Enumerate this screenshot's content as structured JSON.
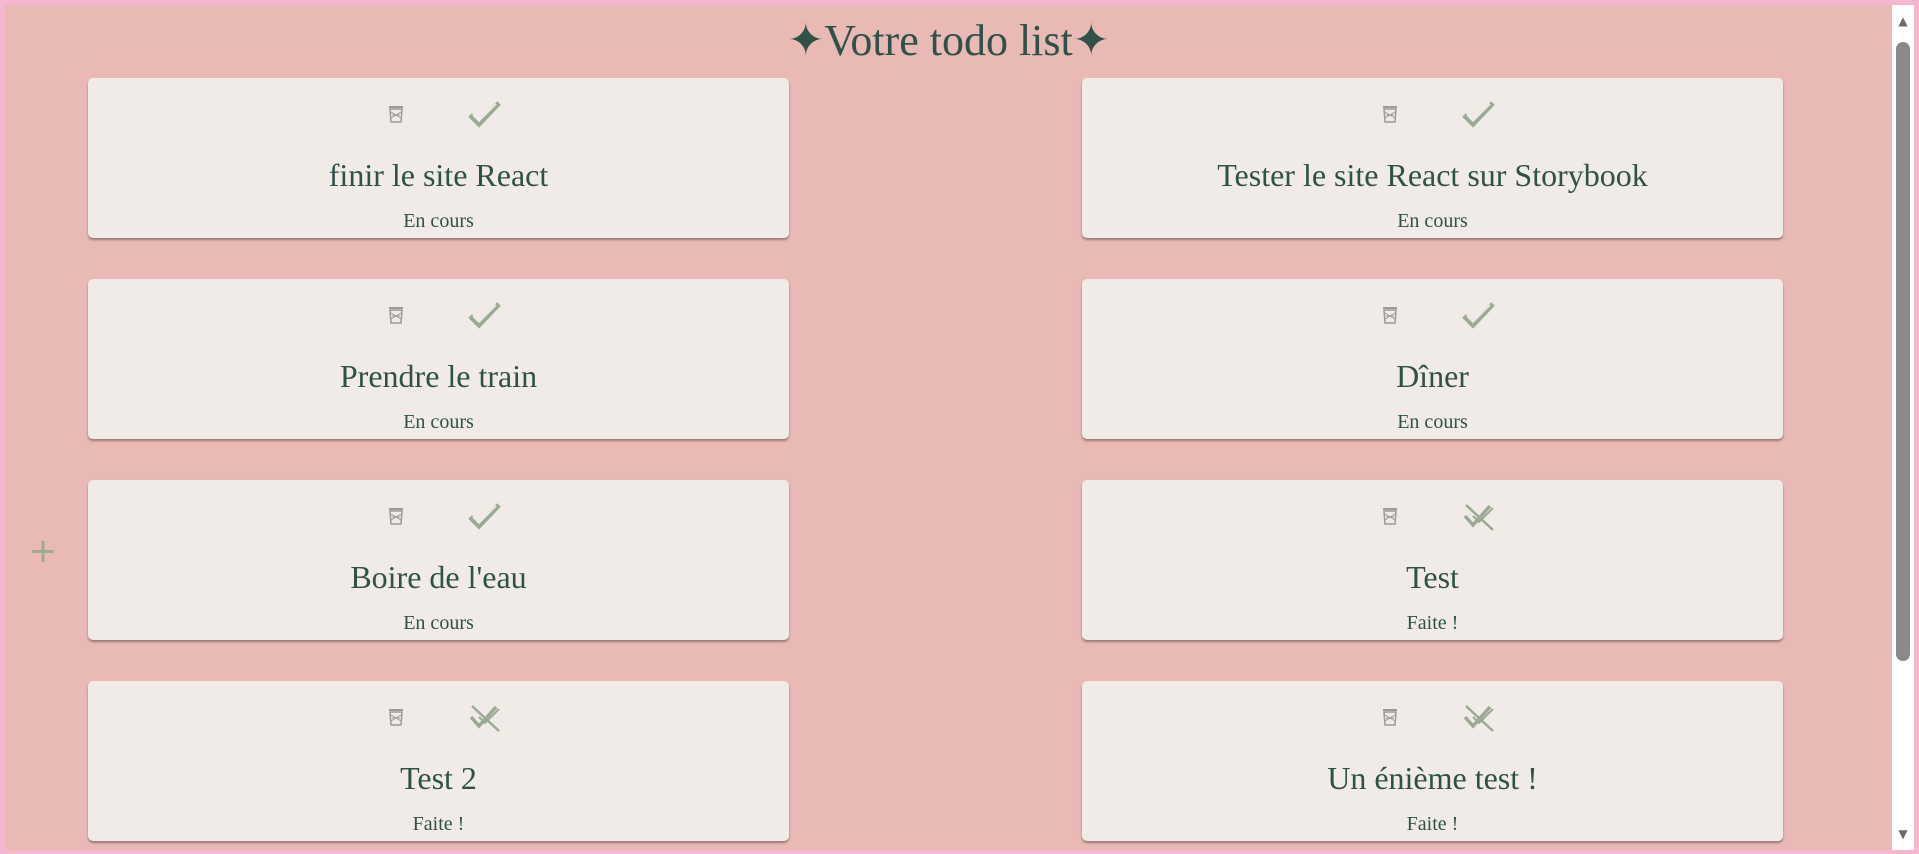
{
  "page": {
    "title": "✦Votre todo list✦",
    "add_button": "+"
  },
  "colors": {
    "background": "#e9b9b5",
    "card": "#f0ebe7",
    "text": "#2f5148",
    "icon_green": "#9aab91",
    "icon_gray": "#a09a96",
    "border": "#f7b6d0"
  },
  "todos": [
    {
      "title": "finir le site React",
      "status": "En cours",
      "done": false,
      "check_icon": "check-icon"
    },
    {
      "title": "Tester le site React sur Storybook",
      "status": "En cours",
      "done": false,
      "check_icon": "check-icon"
    },
    {
      "title": "Prendre le train",
      "status": "En cours",
      "done": false,
      "check_icon": "check-icon"
    },
    {
      "title": "Dîner",
      "status": "En cours",
      "done": false,
      "check_icon": "check-icon"
    },
    {
      "title": "Boire de l'eau",
      "status": "En cours",
      "done": false,
      "check_icon": "check-icon"
    },
    {
      "title": "Test",
      "status": "Faite !",
      "done": true,
      "check_icon": "uncheck-icon"
    },
    {
      "title": "Test 2",
      "status": "Faite !",
      "done": true,
      "check_icon": "uncheck-icon"
    },
    {
      "title": "Un énième test !",
      "status": "Faite !",
      "done": true,
      "check_icon": "uncheck-icon"
    }
  ]
}
